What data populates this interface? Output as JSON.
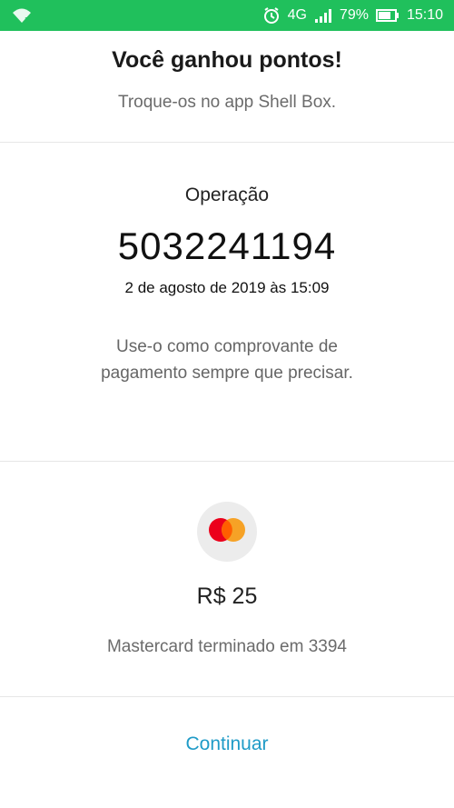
{
  "status_bar": {
    "network": "4G",
    "battery_percent": "79%",
    "time": "15:10",
    "icons": [
      "wifi-question-icon",
      "alarm-icon",
      "signal-icon",
      "battery-icon"
    ]
  },
  "header": {
    "title": "Você ganhou pontos!",
    "subtitle": "Troque-os no app Shell Box."
  },
  "operation": {
    "label": "Operação",
    "number": "5032241194",
    "date": "2 de agosto de 2019 às 15:09",
    "note_line1": "Use-o como comprovante de",
    "note_line2": "pagamento sempre que precisar."
  },
  "payment": {
    "card_icon": "mastercard-icon",
    "amount": "R$ 25",
    "card_text": "Mastercard terminado em 3394",
    "colors": {
      "red": "#eb001b",
      "orange": "#f79e1b"
    }
  },
  "actions": {
    "continue_label": "Continuar",
    "accent": "#1f9bc7"
  }
}
